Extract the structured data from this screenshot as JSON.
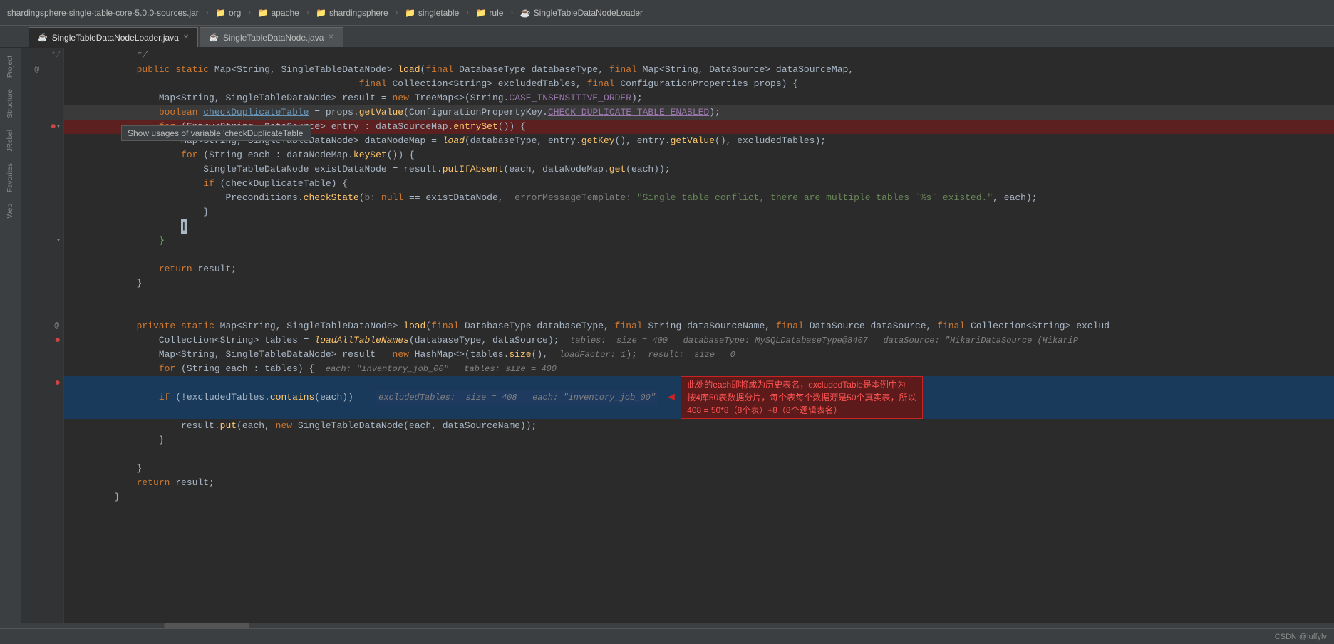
{
  "titleBar": {
    "jarName": "shardingsphere-single-table-core-5.0.0-sources.jar",
    "breadcrumbs": [
      {
        "icon": "folder",
        "label": "org"
      },
      {
        "icon": "folder",
        "label": "apache"
      },
      {
        "icon": "folder",
        "label": "shardingsphere"
      },
      {
        "icon": "folder",
        "label": "singletable"
      },
      {
        "icon": "folder",
        "label": "rule"
      },
      {
        "icon": "java",
        "label": "SingleTableDataNodeLoader"
      }
    ]
  },
  "tabs": [
    {
      "label": "SingleTableDataNodeLoader.java",
      "active": true
    },
    {
      "label": "SingleTableDataNode.java",
      "active": false
    }
  ],
  "tooltip": {
    "text": "Show usages of variable 'checkDuplicateTable'"
  },
  "statusBar": {
    "text": "CSDN @luffylv"
  },
  "code": {
    "lines": [
      {
        "num": "",
        "content": "*/",
        "type": "comment"
      },
      {
        "num": "",
        "content": "public static Map<String, SingleTableDataNode> load(final DatabaseType databaseType, final Map<String, DataSource> dataSourceMap,",
        "type": "normal"
      },
      {
        "num": "",
        "content": "                                                    final Collection<String> excludedTables, final ConfigurationProperties props) {",
        "type": "normal"
      },
      {
        "num": "",
        "content": "    Map<String, SingleTableDataNode> result = new TreeMap<>(String.CASE_INSENSITIVE_ORDER);",
        "type": "normal"
      },
      {
        "num": "",
        "content": "    boolean checkDuplicateTable = props.getValue(ConfigurationPropertyKey.CHECK_DUPLICATE_TABLE_ENABLED);",
        "type": "highlighted"
      },
      {
        "num": "",
        "content": "    for (Entry<String, DataSource> entry : dataSourceMap.entrySet()) {",
        "type": "highlighted-red"
      },
      {
        "num": "",
        "content": "        Map<String, SingleTableDataNode> dataNodeMap = load(databaseType, entry.getKey(), entry.getValue(), excludedTables);",
        "type": "normal"
      },
      {
        "num": "",
        "content": "        for (String each : dataNodeMap.keySet()) {",
        "type": "normal"
      },
      {
        "num": "",
        "content": "            SingleTableDataNode existDataNode = result.putIfAbsent(each, dataNodeMap.get(each));",
        "type": "normal"
      },
      {
        "num": "",
        "content": "            if (checkDuplicateTable) {",
        "type": "normal"
      },
      {
        "num": "",
        "content": "                Preconditions.checkState( b: null == existDataNode,  errorMessageTemplate: \"Single table conflict, there are multiple tables `%s` existed.\", each);",
        "type": "normal"
      },
      {
        "num": "",
        "content": "            }",
        "type": "normal"
      },
      {
        "num": "",
        "content": "        |",
        "type": "cursor"
      },
      {
        "num": "",
        "content": "    }",
        "type": "normal"
      },
      {
        "num": "",
        "content": "",
        "type": "blank"
      },
      {
        "num": "",
        "content": "    return result;",
        "type": "normal"
      },
      {
        "num": "",
        "content": "}",
        "type": "normal"
      },
      {
        "num": "",
        "content": "",
        "type": "blank"
      },
      {
        "num": "",
        "content": "",
        "type": "blank"
      },
      {
        "num": "",
        "content": "private static Map<String, SingleTableDataNode> load(final DatabaseType databaseType, final String dataSourceName, final DataSource dataSource, final Collection<String> exclud",
        "type": "normal"
      },
      {
        "num": "",
        "content": "    Collection<String> tables = loadAllTableNames(databaseType, dataSource);  tables: size = 400  databaseType: MySQLDatabaseType@8407  dataSource: \"HikariDataSource (HikariP",
        "type": "debug"
      },
      {
        "num": "",
        "content": "    Map<String, SingleTableDataNode> result = new HashMap<>(tables.size(),  loadFactor: 1);  result: size = 0",
        "type": "debug"
      },
      {
        "num": "",
        "content": "    for (String each : tables) {  each: \"inventory_job_00\"  tables: size = 400",
        "type": "debug"
      },
      {
        "num": "",
        "content": "    if (!excludedTables.contains(each))    excludedTables: size = 408  each: \"inventory_job_00\"",
        "type": "highlighted-blue-with-annotation"
      },
      {
        "num": "",
        "content": "        result.put(each, new SingleTableDataNode(each, dataSourceName));",
        "type": "normal"
      },
      {
        "num": "",
        "content": "    }",
        "type": "normal"
      },
      {
        "num": "",
        "content": "",
        "type": "blank"
      },
      {
        "num": "",
        "content": "    }",
        "type": "normal"
      },
      {
        "num": "",
        "content": "    return result;",
        "type": "normal"
      },
      {
        "num": "",
        "content": "}",
        "type": "normal"
      }
    ]
  },
  "annotation": {
    "text": "此处的each即将成为历史表名，excludedTable是本例中为\n按4库50表数据分片，每个表每个数据源是50个真实表，所以\n408 = 50*8（8个表）+8（8个逻辑表名）"
  }
}
